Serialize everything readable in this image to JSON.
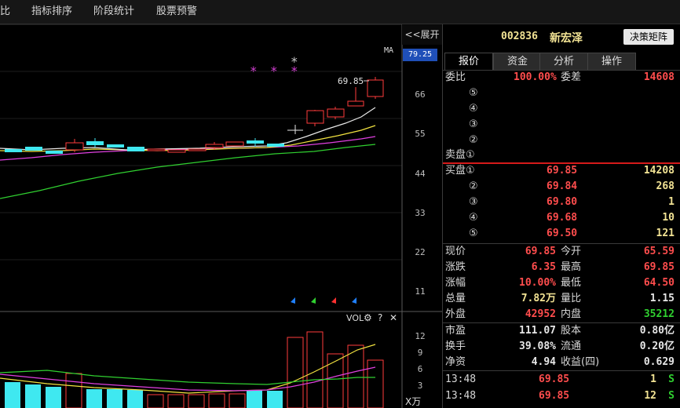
{
  "topbar": {
    "items": [
      "比",
      "指标排序",
      "阶段统计",
      "股票预警"
    ]
  },
  "chart": {
    "expand_label": "<<展开",
    "ma_label": "MA",
    "current_price_tag": "79.25",
    "peak_label": "69.85",
    "price_axis": [
      "66",
      "55",
      "44",
      "33",
      "22",
      "11"
    ],
    "vol_title": "VOL",
    "vol_axis": [
      "12",
      "9",
      "6",
      "3"
    ],
    "vol_unit": "X万",
    "colors": {
      "up": "#ff3c3c",
      "down": "#3fe8f0",
      "ma5": "#ffffff",
      "ma10": "#f2e340",
      "ma20": "#e040e0",
      "ma60": "#30d030"
    }
  },
  "stock": {
    "code": "002836",
    "name": "新宏泽",
    "button": "决策矩阵"
  },
  "tabs": [
    "报价",
    "资金",
    "分析",
    "操作"
  ],
  "weibi": {
    "l1": "委比",
    "v1": "100.00%",
    "l2": "委差",
    "v2": "14608"
  },
  "sell": {
    "rows": [
      {
        "idx": "⑤",
        "price": "",
        "vol": ""
      },
      {
        "idx": "④",
        "price": "",
        "vol": ""
      },
      {
        "idx": "③",
        "price": "",
        "vol": ""
      },
      {
        "idx": "②",
        "price": "",
        "vol": ""
      },
      {
        "idx": "卖盘①",
        "price": "",
        "vol": ""
      }
    ]
  },
  "buy": {
    "rows": [
      {
        "idx": "买盘①",
        "price": "69.85",
        "vol": "14208"
      },
      {
        "idx": "②",
        "price": "69.84",
        "vol": "268"
      },
      {
        "idx": "③",
        "price": "69.80",
        "vol": "1"
      },
      {
        "idx": "④",
        "price": "69.68",
        "vol": "10"
      },
      {
        "idx": "⑤",
        "price": "69.50",
        "vol": "121"
      }
    ]
  },
  "quote": [
    {
      "l1": "现价",
      "v1": "69.85",
      "c1": "red",
      "l2": "今开",
      "v2": "65.59",
      "c2": "red"
    },
    {
      "l1": "涨跌",
      "v1": "6.35",
      "c1": "red",
      "l2": "最高",
      "v2": "69.85",
      "c2": "red"
    },
    {
      "l1": "涨幅",
      "v1": "10.00%",
      "c1": "red",
      "l2": "最低",
      "v2": "64.50",
      "c2": "red"
    },
    {
      "l1": "总量",
      "v1": "7.82万",
      "c1": "yel",
      "l2": "量比",
      "v2": "1.15",
      "c2": "wht"
    },
    {
      "l1": "外盘",
      "v1": "42952",
      "c1": "red",
      "l2": "内盘",
      "v2": "35212",
      "c2": "grn"
    }
  ],
  "fund": [
    {
      "l1": "市盈",
      "v1": "111.07",
      "l2": "股本",
      "v2": "0.80亿"
    },
    {
      "l1": "换手",
      "v1": "39.08%",
      "l2": "流通",
      "v2": "0.20亿"
    },
    {
      "l1": "净资",
      "v1": "4.94",
      "l2": "收益(四)",
      "v2": "0.629"
    }
  ],
  "ticks": [
    {
      "time": "13:48",
      "price": "69.85",
      "vol": "1",
      "side": "S"
    },
    {
      "time": "13:48",
      "price": "69.85",
      "vol": "12",
      "side": "S"
    }
  ]
}
